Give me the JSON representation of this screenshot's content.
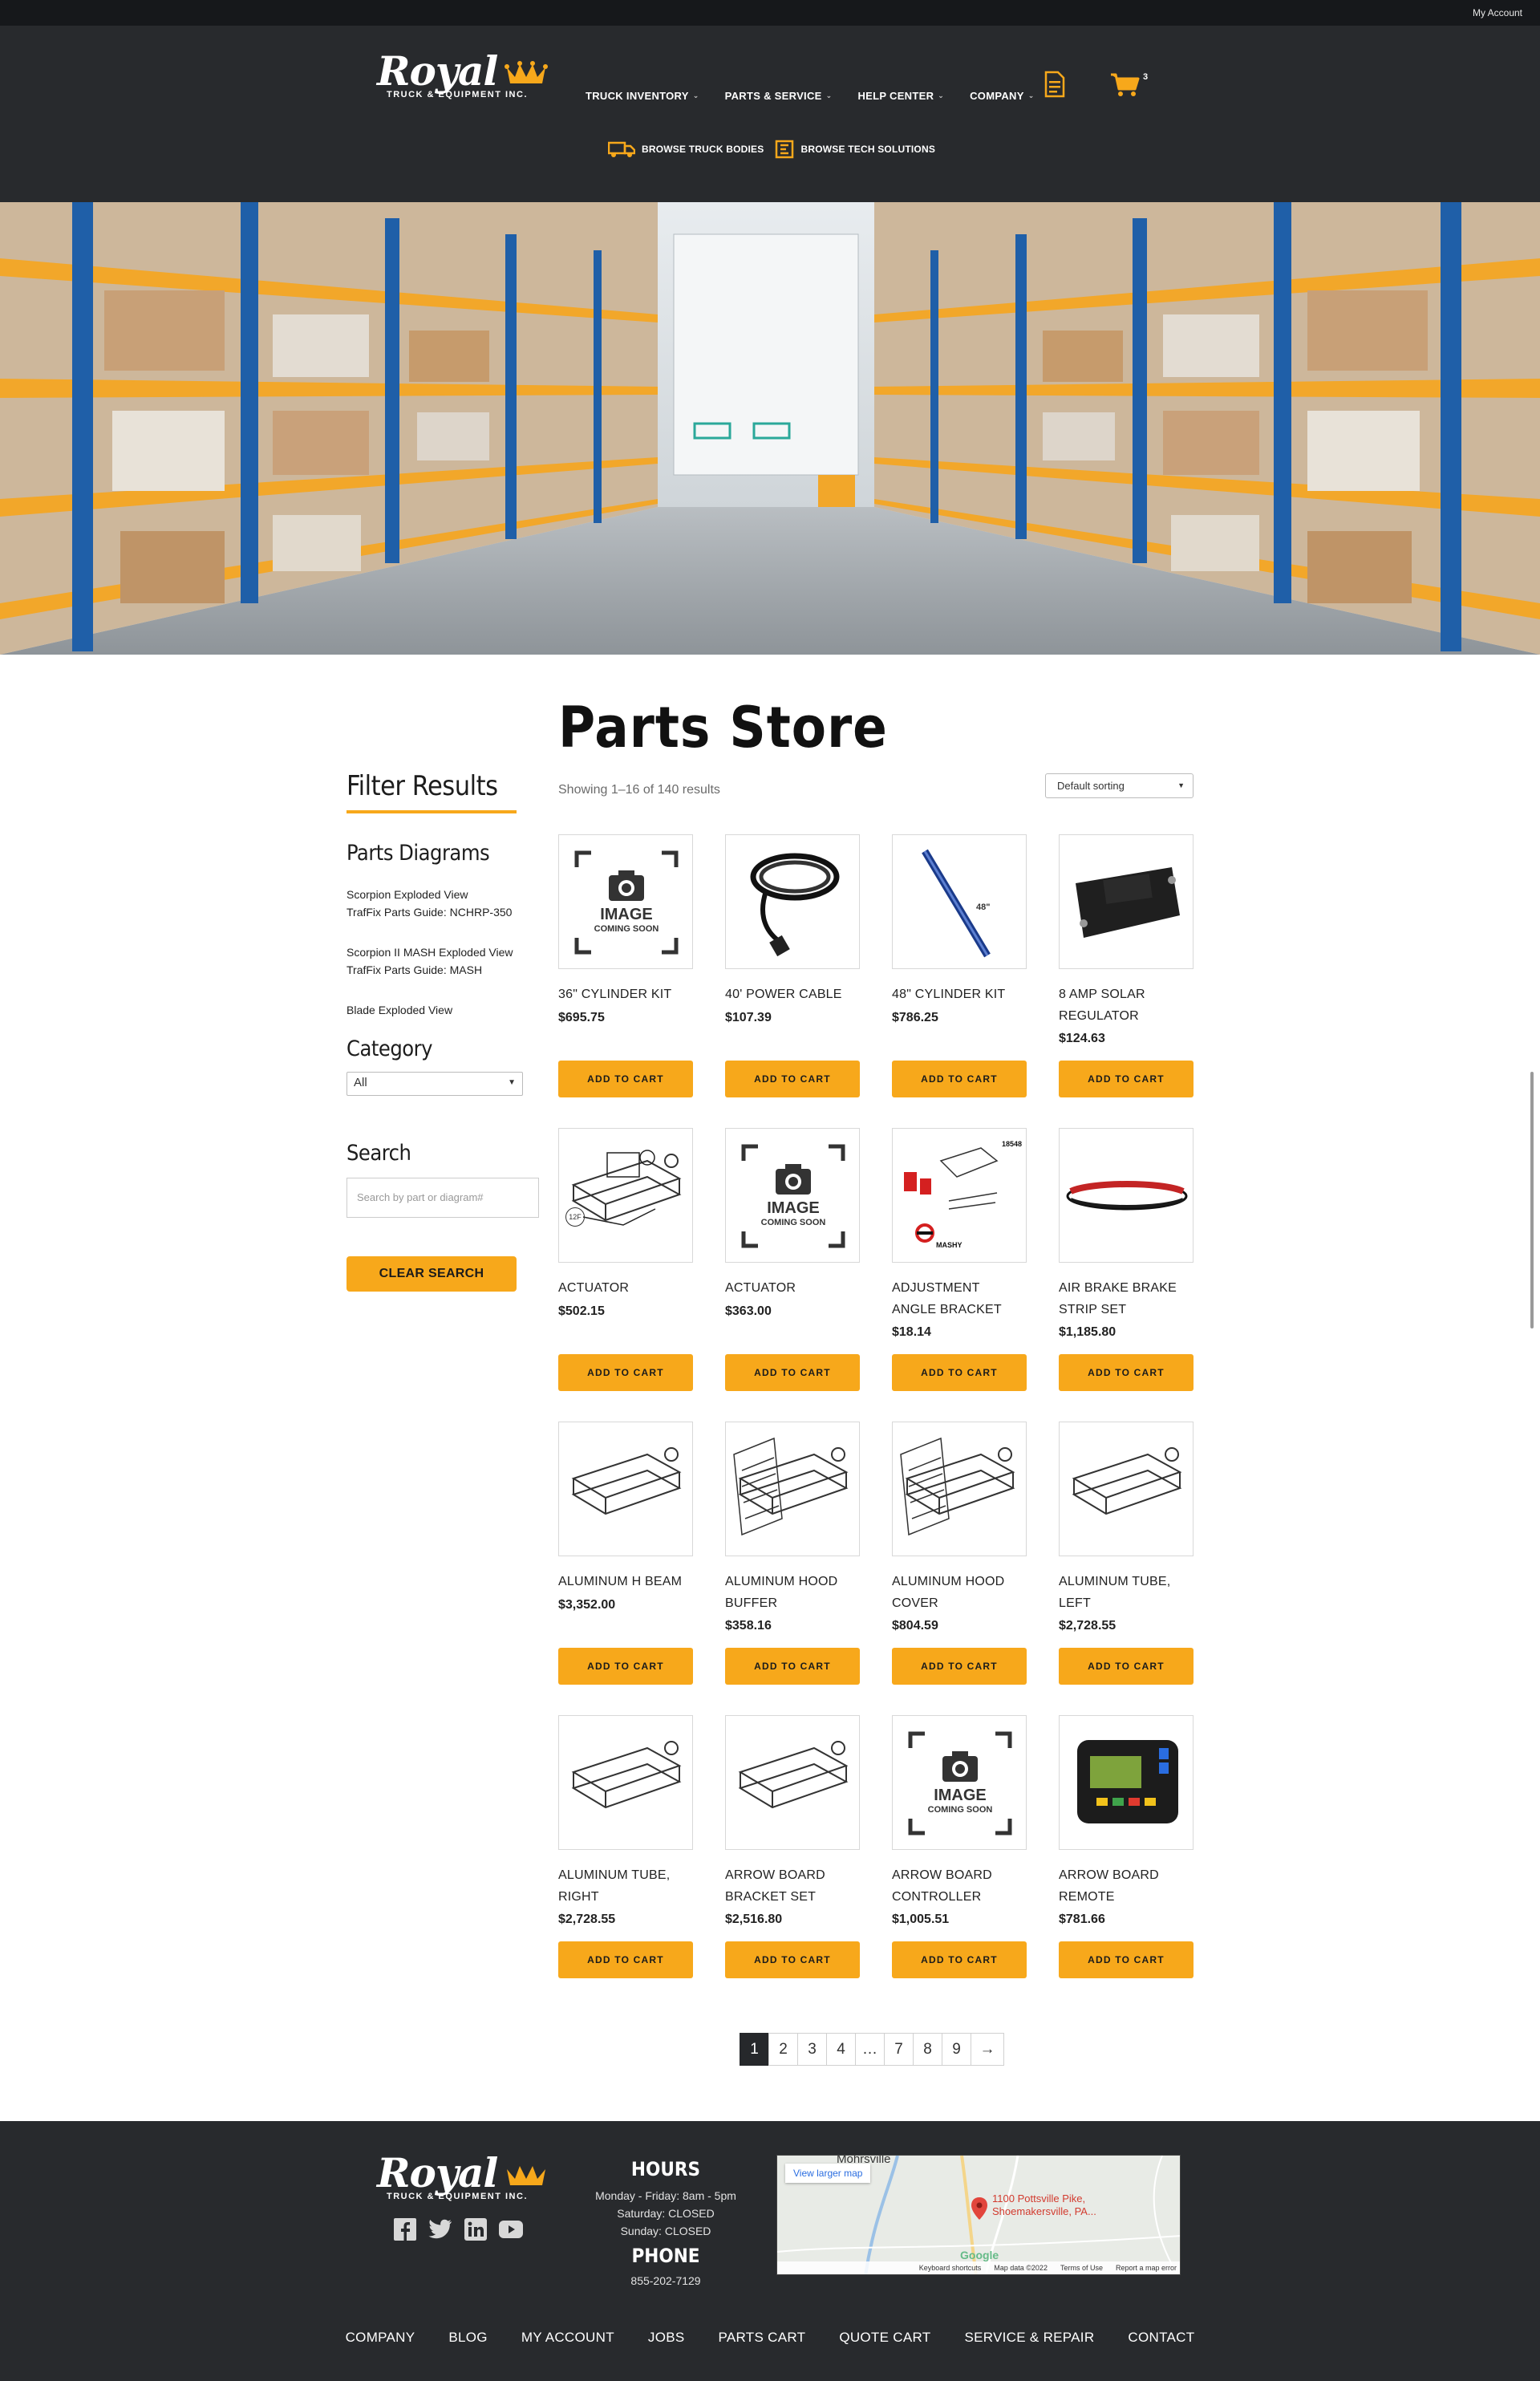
{
  "topbar": {
    "account_label": "My Account"
  },
  "brand": {
    "name": "Royal",
    "tagline": "TRUCK & EQUIPMENT INC."
  },
  "nav": {
    "items": [
      {
        "label": "TRUCK INVENTORY"
      },
      {
        "label": "PARTS & SERVICE"
      },
      {
        "label": "HELP CENTER"
      },
      {
        "label": "COMPANY"
      }
    ],
    "cart_count": "3",
    "sub": [
      {
        "label": "BROWSE TRUCK BODIES"
      },
      {
        "label": "BROWSE TECH SOLUTIONS"
      }
    ]
  },
  "sidebar": {
    "filter_title": "Filter Results",
    "diagrams_title": "Parts Diagrams",
    "diagrams": [
      "Scorpion Exploded View",
      "TrafFix Parts Guide: NCHRP-350",
      "Scorpion II MASH Exploded View",
      "TrafFix Parts Guide: MASH",
      "Blade Exploded View"
    ],
    "category_title": "Category",
    "category_value": "All",
    "search_title": "Search",
    "search_placeholder": "Search by part or diagram#",
    "clear_label": "CLEAR SEARCH"
  },
  "main": {
    "title": "Parts Store",
    "result_count": "Showing 1–16 of 140 results",
    "sort_value": "Default sorting",
    "add_label": "ADD TO CART",
    "coming_soon_1": "IMAGE",
    "coming_soon_2": "COMING SOON",
    "products": [
      {
        "name": "36\" CYLINDER KIT",
        "price": "$695.75",
        "img": "coming-soon"
      },
      {
        "name": "40' POWER CABLE",
        "price": "$107.39",
        "img": "cable"
      },
      {
        "name": "48\" CYLINDER KIT",
        "price": "$786.25",
        "img": "cylinder"
      },
      {
        "name": "8 AMP SOLAR REGULATOR",
        "price": "$124.63",
        "img": "regulator"
      },
      {
        "name": "ACTUATOR",
        "price": "$502.15",
        "img": "actuator"
      },
      {
        "name": "ACTUATOR",
        "price": "$363.00",
        "img": "coming-soon"
      },
      {
        "name": "ADJUSTMENT ANGLE BRACKET",
        "price": "$18.14",
        "img": "bracket"
      },
      {
        "name": "AIR BRAKE BRAKE STRIP SET",
        "price": "$1,185.80",
        "img": "strip"
      },
      {
        "name": "ALUMINUM H BEAM",
        "price": "$3,352.00",
        "img": "beam"
      },
      {
        "name": "ALUMINUM HOOD BUFFER",
        "price": "$358.16",
        "img": "hood"
      },
      {
        "name": "ALUMINUM HOOD COVER",
        "price": "$804.59",
        "img": "hood"
      },
      {
        "name": "ALUMINUM TUBE, LEFT",
        "price": "$2,728.55",
        "img": "tube"
      },
      {
        "name": "ALUMINUM TUBE, RIGHT",
        "price": "$2,728.55",
        "img": "beam"
      },
      {
        "name": "ARROW BOARD BRACKET SET",
        "price": "$2,516.80",
        "img": "arrowbracket"
      },
      {
        "name": "ARROW BOARD CONTROLLER",
        "price": "$1,005.51",
        "img": "coming-soon"
      },
      {
        "name": "ARROW BOARD REMOTE",
        "price": "$781.66",
        "img": "remote"
      }
    ],
    "image_labels": {
      "cylinder_tag": "48\"",
      "bracket_num": "18548",
      "bracket_logo": "MASHY",
      "actuator_tag": "12F"
    }
  },
  "pagination": {
    "pages": [
      "1",
      "2",
      "3",
      "4",
      "…",
      "7",
      "8",
      "9",
      "→"
    ]
  },
  "footer": {
    "hours_title": "HOURS",
    "hours": [
      "Monday - Friday: 8am - 5pm",
      "Saturday: CLOSED",
      "Sunday: CLOSED"
    ],
    "phone_title": "PHONE",
    "phone": "855-202-7129",
    "map": {
      "view_larger": "View larger map",
      "address_1": "1100 Pottsville Pike,",
      "address_2": "Shoemakersville, PA...",
      "town": "Mohrsville",
      "google": "Google",
      "footer_links": [
        "Keyboard shortcuts",
        "Map data ©2022",
        "Terms of Use",
        "Report a map error"
      ]
    },
    "links": [
      "COMPANY",
      "BLOG",
      "MY ACCOUNT",
      "JOBS",
      "PARTS CART",
      "QUOTE CART",
      "SERVICE & REPAIR",
      "CONTACT"
    ]
  },
  "colors": {
    "accent": "#f7a81b",
    "header_bg": "#282a2d",
    "topbar_bg": "#16181b"
  }
}
